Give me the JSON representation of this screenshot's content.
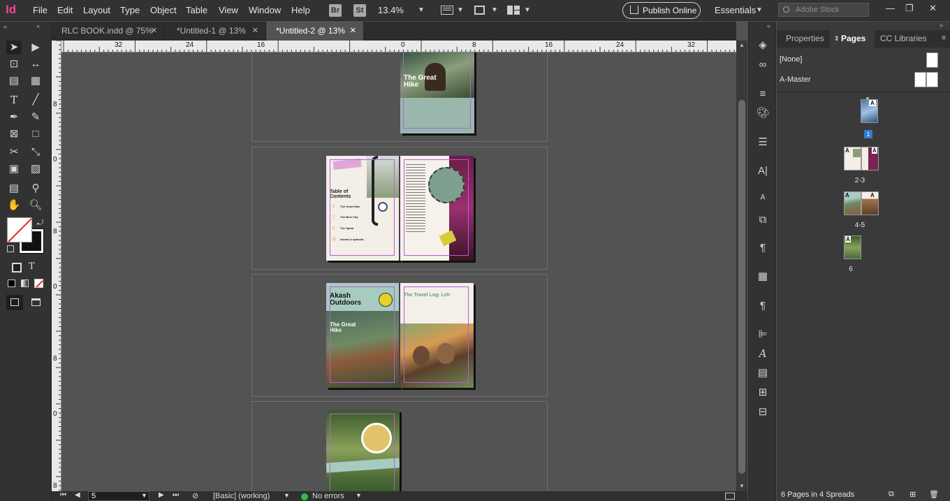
{
  "app": {
    "logo": "Id",
    "menus": [
      "File",
      "Edit",
      "Layout",
      "Type",
      "Object",
      "Table",
      "View",
      "Window",
      "Help"
    ],
    "bridge_badge": "Br",
    "stock_badge": "St",
    "zoom": "13.4%",
    "publish_label": "Publish Online",
    "workspace": "Essentials",
    "search_placeholder": "Adobe Stock"
  },
  "tabs": [
    {
      "label": "RLC BOOK.indd @ 75%",
      "active": false
    },
    {
      "label": "*Untitled-1 @ 13%",
      "active": false
    },
    {
      "label": "*Untitled-2 @ 13%",
      "active": true
    }
  ],
  "rulers": {
    "h_ticks": [
      "32",
      "24",
      "16",
      "0",
      "8",
      "16",
      "24",
      "32"
    ],
    "v_ticks": [
      "8",
      "0",
      "8",
      "0",
      "8",
      "0",
      "8"
    ]
  },
  "spreads": [
    {
      "left_title": "",
      "right_title": "",
      "cover_title": "The Great Hike"
    },
    {
      "toc_title": "Table of Contents",
      "toc_items": [
        "The Great Hike",
        "The Blue City",
        "The Spiral",
        "Ahead is optional."
      ],
      "toc_nums": [
        "3",
        "7",
        "9",
        "11"
      ]
    },
    {
      "left_title": "Akash Outdoors",
      "left_sub": "The Great Hike",
      "right_title": "The Travel Log: Leh"
    },
    {
      "page": "6"
    }
  ],
  "status": {
    "page_number": "5",
    "preflight_profile": "[Basic] (working)",
    "errors": "No errors"
  },
  "panel": {
    "tabs": [
      "Properties",
      "Pages",
      "CC Libraries"
    ],
    "active_tab": "Pages",
    "masters": [
      "[None]",
      "A-Master"
    ],
    "page_labels": [
      "1",
      "2-3",
      "4-5",
      "6"
    ],
    "master_prefix": "A",
    "footer": "6 Pages in 4 Spreads"
  },
  "colors": {
    "accent_pink": "#fd3f93",
    "margin_guide": "#b85be0",
    "page_selected": "#2d7dd2"
  }
}
